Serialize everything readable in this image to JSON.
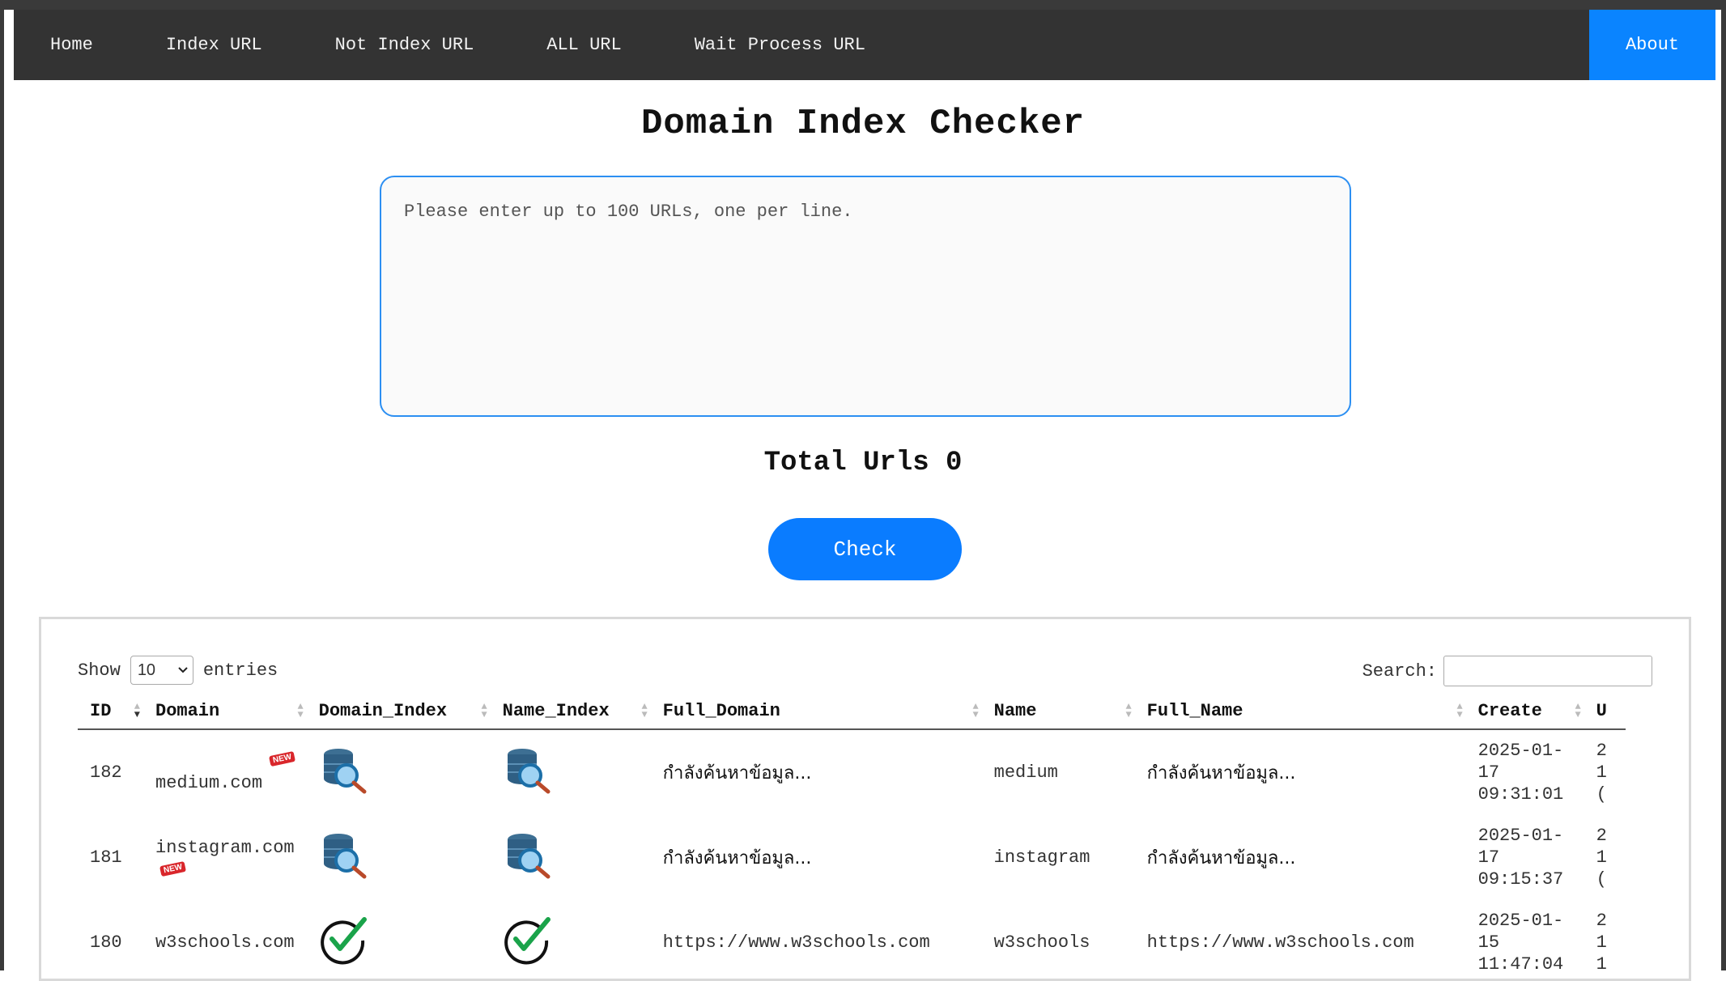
{
  "nav": {
    "items": [
      "Home",
      "Index URL",
      "Not Index URL",
      "ALL URL",
      "Wait Process URL"
    ],
    "about": "About",
    "about_color": "#0a84ff"
  },
  "title": "Domain Index Checker",
  "url_input": {
    "placeholder": "Please enter up to 100 URLs, one per line.",
    "value": ""
  },
  "total_urls": "Total Urls 0",
  "check_button": "Check",
  "table_controls": {
    "show_label": "Show",
    "show_value": "10",
    "entries_label": "entries",
    "search_label": "Search:"
  },
  "table": {
    "columns": [
      "ID",
      "Domain",
      "Domain_Index",
      "Name_Index",
      "Full_Domain",
      "Name",
      "Full_Name",
      "Create",
      "U"
    ],
    "rows": [
      {
        "id": "182",
        "domain": "medium.com",
        "new": true,
        "new_label": "NEW",
        "domain_index": "searching-db-icon",
        "name_index": "searching-db-icon",
        "full_domain": "กำลังค้นหาข้อมูล...",
        "name": "medium",
        "full_name": "กำลังค้นหาข้อมูล...",
        "create": [
          "2025-01-",
          "17",
          "09:31:01"
        ],
        "u": [
          "2",
          "1",
          "("
        ]
      },
      {
        "id": "181",
        "domain": "instagram.com",
        "new": true,
        "new_label": "NEW",
        "domain_index": "searching-db-icon",
        "name_index": "searching-db-icon",
        "full_domain": "กำลังค้นหาข้อมูล...",
        "name": "instagram",
        "full_name": "กำลังค้นหาข้อมูล...",
        "create": [
          "2025-01-",
          "17",
          "09:15:37"
        ],
        "u": [
          "2",
          "1",
          "("
        ]
      },
      {
        "id": "180",
        "domain": "w3schools.com",
        "new": false,
        "domain_index": "green-check-icon",
        "name_index": "green-check-icon",
        "full_domain": "https://www.w3schools.com",
        "name": "w3schools",
        "full_name": "https://www.w3schools.com",
        "create": [
          "2025-01-",
          "15",
          "11:47:04"
        ],
        "u": [
          "2",
          "1",
          "1"
        ]
      }
    ]
  }
}
